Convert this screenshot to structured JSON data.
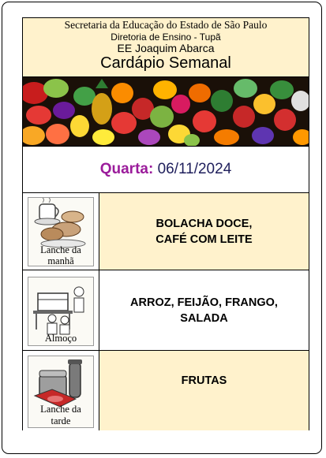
{
  "header": {
    "line1": "Secretaria da Educação do Estado de São Paulo",
    "line2": "Diretoria de Ensino - Tupã",
    "line3": "EE Joaquim Abarca",
    "title": "Cardápio Semanal"
  },
  "day": {
    "label": "Quarta:",
    "date": "06/11/2024"
  },
  "meals": [
    {
      "caption_1": "Lanche da",
      "caption_2": "manhã",
      "food_1": "BOLACHA DOCE,",
      "food_2": "CAFÉ COM LEITE"
    },
    {
      "caption_1": "Almoço",
      "food_1": "ARROZ, FEIJÃO, FRANGO,",
      "food_2": "SALADA"
    },
    {
      "caption_1": "Lanche da",
      "caption_2": "tarde",
      "food_1": "FRUTAS"
    }
  ],
  "colors": {
    "header_bg": "#fff2cc",
    "day_label": "#9b1c9b",
    "day_date": "#1f1f5c"
  }
}
